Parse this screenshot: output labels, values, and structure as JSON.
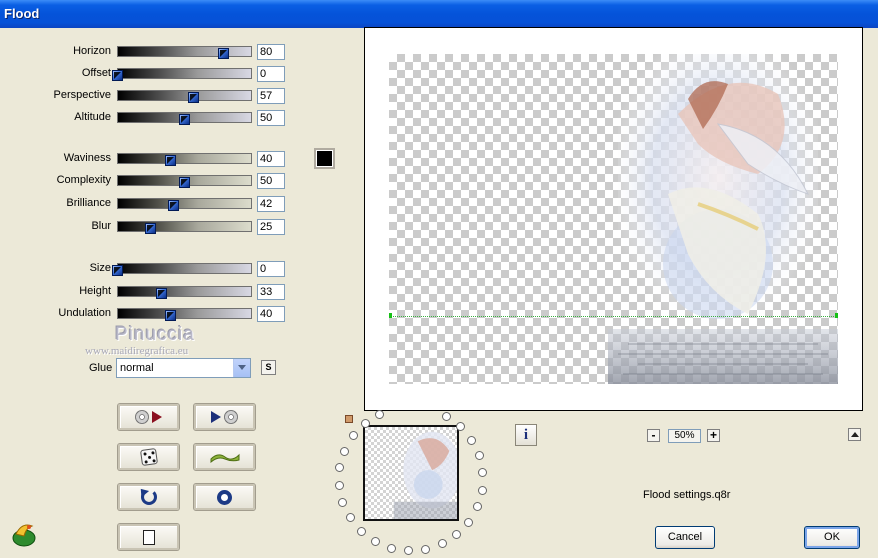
{
  "window": {
    "title": "Flood"
  },
  "sliders_group1": [
    {
      "label": "Horizon",
      "value": "80",
      "level": 0.8,
      "style": "grey"
    },
    {
      "label": "Offset",
      "value": "0",
      "level": 0.0,
      "style": "grey"
    },
    {
      "label": "Perspective",
      "value": "57",
      "level": 0.57,
      "style": "grey"
    },
    {
      "label": "Altitude",
      "value": "50",
      "level": 0.5,
      "style": "grey"
    }
  ],
  "sliders_group2": [
    {
      "label": "Waviness",
      "value": "40",
      "level": 0.4,
      "style": "olive"
    },
    {
      "label": "Complexity",
      "value": "50",
      "level": 0.5,
      "style": "olive"
    },
    {
      "label": "Brilliance",
      "value": "42",
      "level": 0.42,
      "style": "olive"
    },
    {
      "label": "Blur",
      "value": "25",
      "level": 0.25,
      "style": "olive"
    }
  ],
  "sliders_group3": [
    {
      "label": "Size",
      "value": "0",
      "level": 0.0,
      "style": "grey"
    },
    {
      "label": "Height",
      "value": "33",
      "level": 0.33,
      "style": "grey"
    },
    {
      "label": "Undulation",
      "value": "40",
      "level": 0.4,
      "style": "grey"
    }
  ],
  "color_swatch": {
    "color": "#000000"
  },
  "watermark": {
    "name": "Pinuccia",
    "url": "www.maidiregrafica.eu"
  },
  "glue": {
    "label": "Glue",
    "selected": "normal",
    "s_button": "S"
  },
  "toolbar_icons": [
    "load-preset-icon",
    "save-preset-icon",
    "random-dice-icon",
    "wave-icon",
    "undo-icon",
    "reset-icon",
    "copy-icon"
  ],
  "zoom": {
    "value": "50%",
    "minus": "-",
    "plus": "+"
  },
  "info_button": "i",
  "settings_file": "Flood settings.q8r",
  "buttons": {
    "cancel": "Cancel",
    "ok": "OK"
  },
  "colors": {
    "titlebar": "#0A5FE4",
    "dialog_bg": "#ECE9D8",
    "horizon_line": "#16C016"
  }
}
